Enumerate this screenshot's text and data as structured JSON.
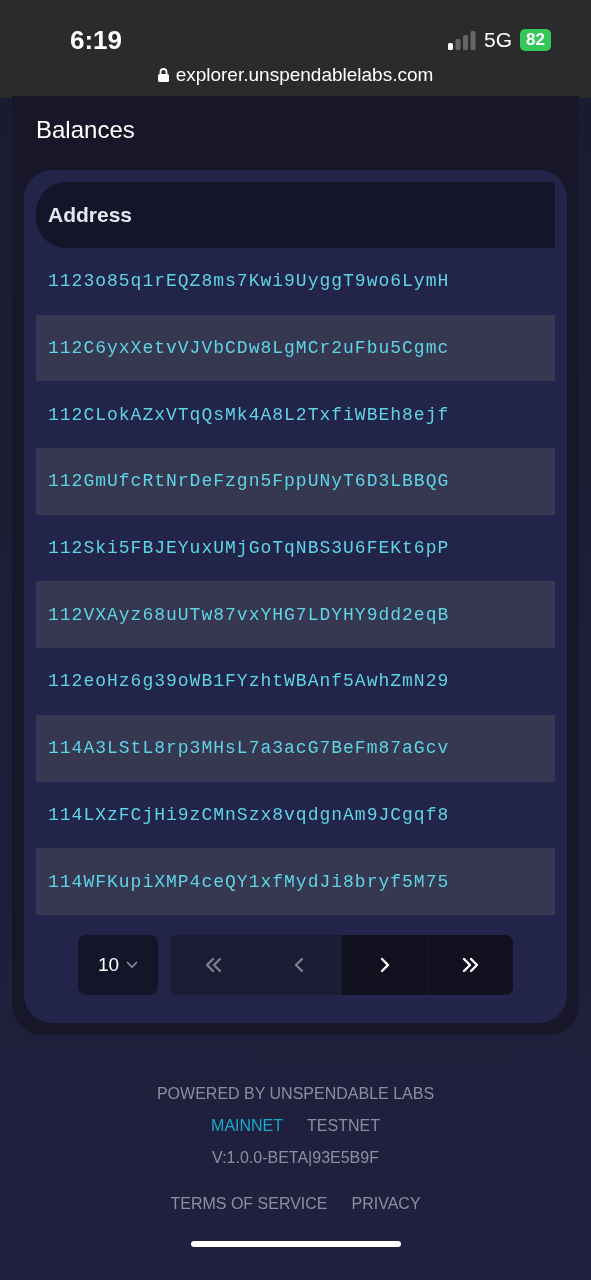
{
  "status_bar": {
    "time": "6:19",
    "network": "5G",
    "battery": "82"
  },
  "browser": {
    "url": "explorer.unspendablelabs.com"
  },
  "balances": {
    "title": "Balances",
    "table": {
      "columns": [
        "Address"
      ],
      "rows": [
        {
          "address": "1123o85q1rEQZ8ms7Kwi9UyggT9wo6LymH"
        },
        {
          "address": "112C6yxXetvVJVbCDw8LgMCr2uFbu5Cgmc"
        },
        {
          "address": "112CLokAZxVTqQsMk4A8L2TxfiWBEh8ejf"
        },
        {
          "address": "112GmUfcRtNrDeFzgn5FppUNyT6D3LBBQG"
        },
        {
          "address": "112Ski5FBJEYuxUMjGoTqNBS3U6FEKt6pP"
        },
        {
          "address": "112VXAyz68uUTw87vxYHG7LDYHY9dd2eqB"
        },
        {
          "address": "112eoHz6g39oWB1FYzhtWBAnf5AwhZmN29"
        },
        {
          "address": "114A3LStL8rp3MHsL7a3acG7BeFm87aGcv"
        },
        {
          "address": "114LXzFCjHi9zCMnSzx8vqdgnAm9JCgqf8"
        },
        {
          "address": "114WFKupiXMP4ceQY1xfMydJi8bryf5M75"
        }
      ]
    },
    "pagination": {
      "page_size": "10",
      "buttons": [
        {
          "kind": "first",
          "disabled": true
        },
        {
          "kind": "previous",
          "disabled": true
        },
        {
          "kind": "next",
          "disabled": false
        },
        {
          "kind": "last",
          "disabled": false
        }
      ]
    }
  },
  "footer": {
    "powered_by": "POWERED BY UNSPENDABLE LABS",
    "networks": [
      {
        "label": "MAINNET",
        "selected": true
      },
      {
        "label": "TESTNET",
        "selected": false
      }
    ],
    "version": "V:1.0.0-BETA|93E5B9F",
    "links": [
      "TERMS OF SERVICE",
      "PRIVACY"
    ]
  }
}
